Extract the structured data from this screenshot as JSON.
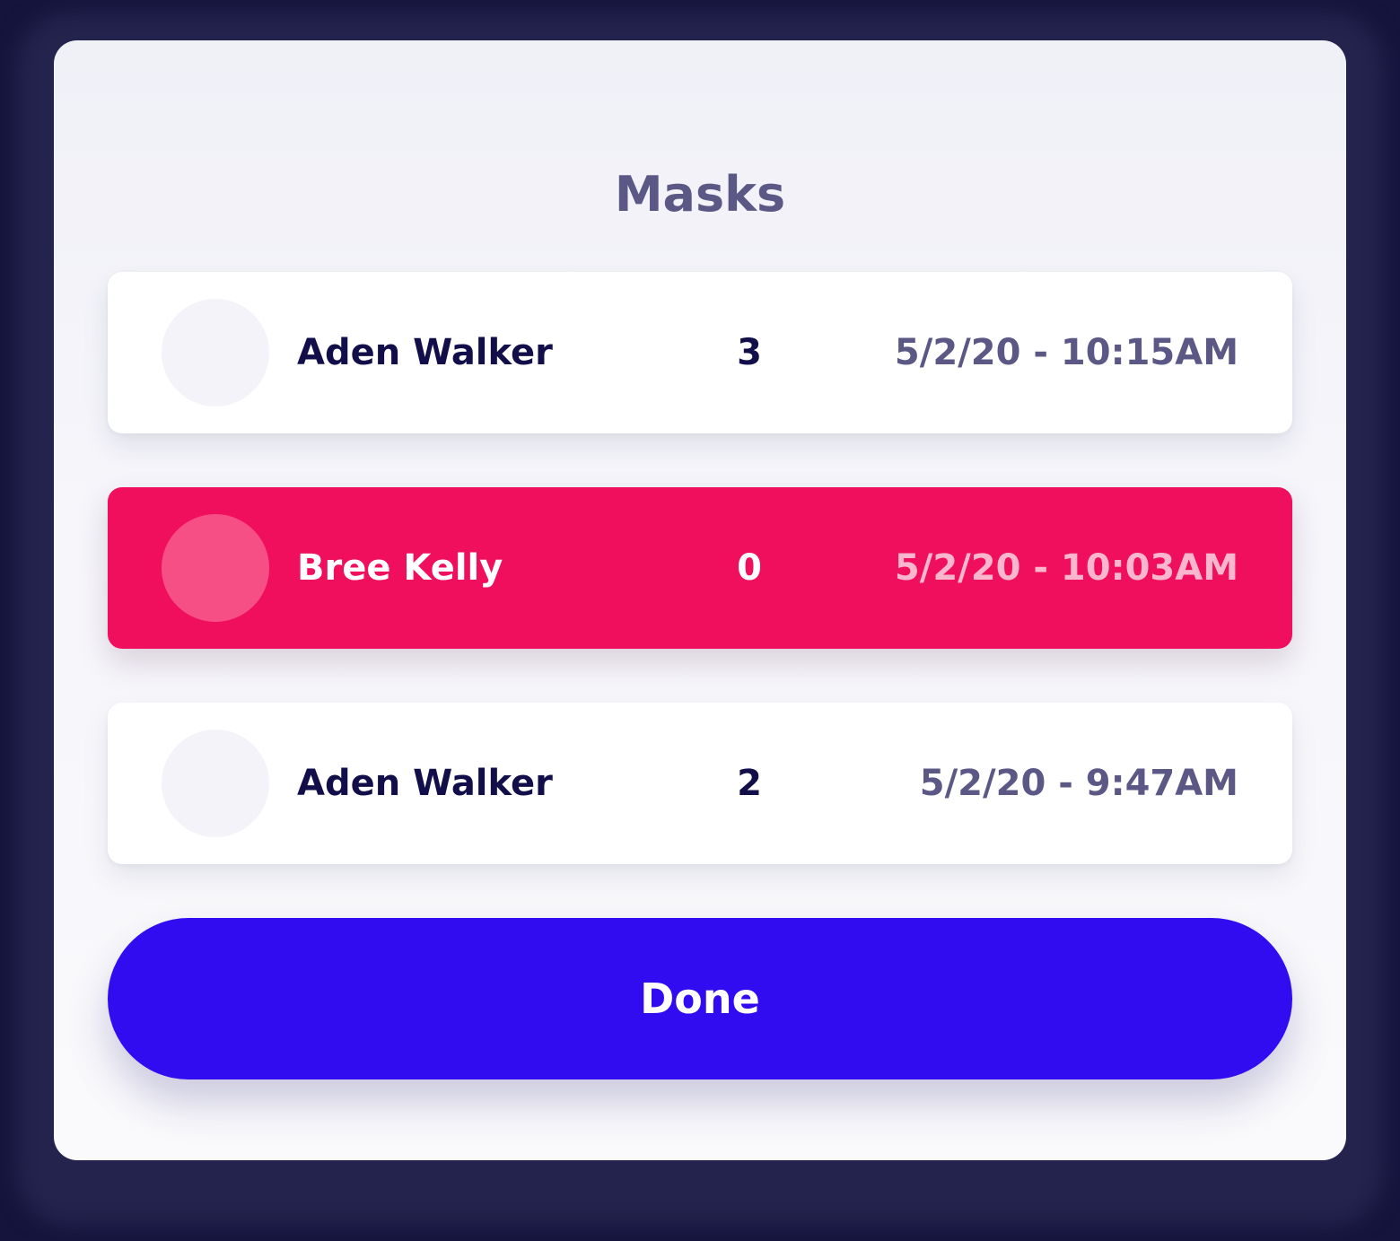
{
  "colors": {
    "accent_button": "#310cf0",
    "selected_row": "#f00f5c",
    "title_text": "#5b5886",
    "primary_text": "#120e4a"
  },
  "modal": {
    "title": "Masks",
    "rows": [
      {
        "name": "Aden Walker",
        "count": "3",
        "timestamp": "5/2/20 - 10:15AM",
        "selected": false
      },
      {
        "name": "Bree Kelly",
        "count": "0",
        "timestamp": "5/2/20 - 10:03AM",
        "selected": true
      },
      {
        "name": "Aden Walker",
        "count": "2",
        "timestamp": "5/2/20 - 9:47AM",
        "selected": false
      }
    ],
    "done_label": "Done"
  }
}
